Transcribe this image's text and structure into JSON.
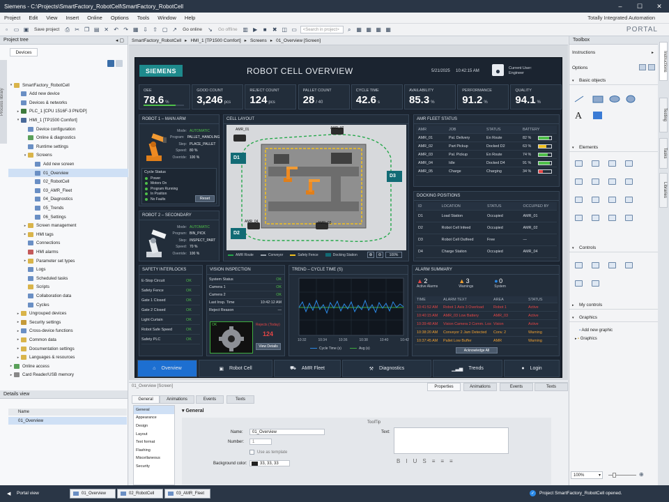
{
  "window": {
    "title": "Siemens  -  C:\\Projects\\SmartFactory_RobotCell\\SmartFactory_RobotCell"
  },
  "menu": [
    "Project",
    "Edit",
    "View",
    "Insert",
    "Online",
    "Options",
    "Tools",
    "Window",
    "Help"
  ],
  "tia": "Totally Integrated Automation",
  "portal": "PORTAL",
  "toolbar": {
    "save": "Save project",
    "go_online": "Go online",
    "go_offline": "Go offline",
    "search_placeholder": "<Search in project>"
  },
  "project_tree": {
    "title": "Project tree",
    "tab": "Devices",
    "vtab": "Process library",
    "items": [
      {
        "label": "SmartFactory_RobotCell",
        "level": 0,
        "arrow": "▾",
        "color": "#d9b44a"
      },
      {
        "label": "Add new device",
        "level": 1,
        "arrow": "",
        "color": "#6a8fc4"
      },
      {
        "label": "Devices & networks",
        "level": 1,
        "arrow": "",
        "color": "#6a8fc4"
      },
      {
        "label": "PLC_1 [CPU 1516F-3 PN/DP]",
        "level": 1,
        "arrow": "▸",
        "color": "#3d7a3d"
      },
      {
        "label": "HMI_1 [TP1500 Comfort]",
        "level": 1,
        "arrow": "▾",
        "color": "#4a6a9a"
      },
      {
        "label": "Device configuration",
        "level": 2,
        "arrow": "",
        "color": "#6a8fc4"
      },
      {
        "label": "Online & diagnostics",
        "level": 2,
        "arrow": "",
        "color": "#5aa05a"
      },
      {
        "label": "Runtime settings",
        "level": 2,
        "arrow": "",
        "color": "#6a8fc4"
      },
      {
        "label": "Screens",
        "level": 2,
        "arrow": "▾",
        "color": "#d9b44a"
      },
      {
        "label": "Add new screen",
        "level": 3,
        "arrow": "",
        "color": "#6a8fc4"
      },
      {
        "label": "01_Overview",
        "level": 3,
        "arrow": "",
        "color": "#6a8fc4",
        "sel": true
      },
      {
        "label": "02_RobotCell",
        "level": 3,
        "arrow": "",
        "color": "#6a8fc4"
      },
      {
        "label": "03_AMR_Fleet",
        "level": 3,
        "arrow": "",
        "color": "#6a8fc4"
      },
      {
        "label": "04_Diagnostics",
        "level": 3,
        "arrow": "",
        "color": "#6a8fc4"
      },
      {
        "label": "05_Trends",
        "level": 3,
        "arrow": "",
        "color": "#6a8fc4"
      },
      {
        "label": "06_Settings",
        "level": 3,
        "arrow": "",
        "color": "#6a8fc4"
      },
      {
        "label": "Screen management",
        "level": 2,
        "arrow": "▸",
        "color": "#d9b44a"
      },
      {
        "label": "HMI tags",
        "level": 2,
        "arrow": "▸",
        "color": "#d9b44a"
      },
      {
        "label": "Connections",
        "level": 2,
        "arrow": "",
        "color": "#6a8fc4"
      },
      {
        "label": "HMI alarms",
        "level": 2,
        "arrow": "",
        "color": "#c45a5a"
      },
      {
        "label": "Parameter set types",
        "level": 2,
        "arrow": "▸",
        "color": "#d9b44a"
      },
      {
        "label": "Logs",
        "level": 2,
        "arrow": "",
        "color": "#6a8fc4"
      },
      {
        "label": "Scheduled tasks",
        "level": 2,
        "arrow": "",
        "color": "#6a8fc4"
      },
      {
        "label": "Scripts",
        "level": 2,
        "arrow": "",
        "color": "#d9b44a"
      },
      {
        "label": "Collaboration data",
        "level": 2,
        "arrow": "",
        "color": "#6a8fc4"
      },
      {
        "label": "Cycles",
        "level": 2,
        "arrow": "",
        "color": "#6a8fc4"
      },
      {
        "label": "Ungrouped devices",
        "level": 1,
        "arrow": "▸",
        "color": "#d9b44a"
      },
      {
        "label": "Security settings",
        "level": 1,
        "arrow": "▸",
        "color": "#c49a3a"
      },
      {
        "label": "Cross-device functions",
        "level": 1,
        "arrow": "▸",
        "color": "#6a8fc4"
      },
      {
        "label": "Common data",
        "level": 1,
        "arrow": "▸",
        "color": "#d9b44a"
      },
      {
        "label": "Documentation settings",
        "level": 1,
        "arrow": "▸",
        "color": "#d9b44a"
      },
      {
        "label": "Languages & resources",
        "level": 1,
        "arrow": "▸",
        "color": "#d9b44a"
      },
      {
        "label": "Online access",
        "level": 0,
        "arrow": "▸",
        "color": "#5aa05a"
      },
      {
        "label": "Card Reader/USB memory",
        "level": 0,
        "arrow": "▸",
        "color": "#888"
      }
    ]
  },
  "details": {
    "title": "Details view",
    "col": "Name",
    "item": "01_Overview"
  },
  "breadcrumb": [
    "SmartFactory_RobotCell",
    "▸",
    "HMI_1 [TP1500 Comfort]",
    "▸",
    "Screens",
    "▸",
    "01_Overview [Screen]"
  ],
  "hmi": {
    "brand": "SIEMENS",
    "title": "ROBOT CELL OVERVIEW",
    "date": "5/21/2025",
    "time": "10:42:15 AM",
    "user_label": "Current User:",
    "user": "Engineer",
    "kpis": [
      {
        "label": "OEE",
        "value": "78.6",
        "unit": "%",
        "cls": "green",
        "bar": 0.786
      },
      {
        "label": "GOOD COUNT",
        "value": "3,246",
        "unit": "pcs",
        "cls": ""
      },
      {
        "label": "REJECT COUNT",
        "value": "124",
        "unit": "pcs",
        "cls": "red"
      },
      {
        "label": "PALLET COUNT",
        "value": "28",
        "unit": "/ 40",
        "cls": ""
      },
      {
        "label": "CYCLE TIME",
        "value": "42.6",
        "unit": "s",
        "cls": ""
      },
      {
        "label": "AVAILABILITY",
        "value": "85.3",
        "unit": "%",
        "cls": ""
      },
      {
        "label": "PERFORMANCE",
        "value": "91.2",
        "unit": "%",
        "cls": ""
      },
      {
        "label": "QUALITY",
        "value": "94.1",
        "unit": "%",
        "cls": ""
      }
    ],
    "robot1": {
      "title": "ROBOT 1 – MAIN ARM",
      "fields": [
        [
          "Mode:",
          "AUTOMATIC"
        ],
        [
          "Program:",
          "PALLET_HANDLING"
        ],
        [
          "Step:",
          "PLACE_PALLET"
        ],
        [
          "Speed:",
          "80 %"
        ],
        [
          "Override:",
          "100 %"
        ]
      ],
      "cycle_title": "Cycle Status",
      "status": [
        "Power",
        "Motors On",
        "Program Running",
        "In Position",
        "No Faults"
      ],
      "reset": "Reset"
    },
    "robot2": {
      "title": "ROBOT 2 – SECONDARY",
      "fields": [
        [
          "Mode:",
          "AUTOMATIC"
        ],
        [
          "Program:",
          "BIN_PICK"
        ],
        [
          "Step:",
          "INSPECT_PART"
        ],
        [
          "Speed:",
          "70 %"
        ],
        [
          "Override:",
          "100 %"
        ]
      ]
    },
    "cell": {
      "title": "CELL LAYOUT",
      "amrs": [
        "AMR_01",
        "AMR_02",
        "AMR_03",
        "AMR_04"
      ],
      "docks": [
        "D1",
        "D2",
        "D3"
      ],
      "legend": [
        "AMR Route",
        "Conveyor",
        "Safety Fence",
        "Docking Station"
      ],
      "zoom": "100%"
    },
    "fleet": {
      "title": "AMR FLEET STATUS",
      "cols": [
        "AMR",
        "JOB",
        "STATUS",
        "BATTERY"
      ],
      "rows": [
        [
          "AMR_01",
          "Pal. Delivery",
          "En Route",
          "82 %",
          0.82
        ],
        [
          "AMR_02",
          "Part Pickup",
          "Docked D2",
          "63 %",
          0.63
        ],
        [
          "AMR_03",
          "Pal. Pickup",
          "En Route",
          "74 %",
          0.74
        ],
        [
          "AMR_04",
          "Idle",
          "Docked D4",
          "91 %",
          0.91
        ],
        [
          "AMR_05",
          "Charge",
          "Charging",
          "34 %",
          0.34
        ]
      ]
    },
    "docking": {
      "title": "DOCKING POSITIONS",
      "cols": [
        "ID",
        "LOCATION",
        "STATUS",
        "OCCUPIED BY"
      ],
      "rows": [
        [
          "D1",
          "Load Station",
          "Occupied",
          "AMR_01"
        ],
        [
          "D2",
          "Robot Cell Infeed",
          "Occupied",
          "AMR_02"
        ],
        [
          "D3",
          "Robot Cell Outfeed",
          "Free",
          "—"
        ],
        [
          "D4",
          "Charge Station",
          "Occupied",
          "AMR_04"
        ]
      ]
    },
    "safety": {
      "title": "SAFETY INTERLOCKS",
      "rows": [
        [
          "E-Stop Circuit",
          "OK"
        ],
        [
          "Safety Fence",
          "OK"
        ],
        [
          "Gate 1 Closed",
          "OK"
        ],
        [
          "Gate 2 Closed",
          "OK"
        ],
        [
          "Light Curtain",
          "OK"
        ],
        [
          "Robot Safe Speed",
          "OK"
        ],
        [
          "Safety PLC",
          "OK"
        ]
      ]
    },
    "vision": {
      "title": "VISION INSPECTION",
      "rows": [
        [
          "System Status",
          "OK"
        ],
        [
          "Camera 1",
          "OK"
        ],
        [
          "Camera 2",
          "OK"
        ],
        [
          "Last Insp. Time",
          "10:42:12 AM"
        ],
        [
          "Reject Reason",
          "—"
        ]
      ],
      "ok": "OK",
      "rejects_label": "Rejects (Today)",
      "rejects": "124",
      "details": "View Details"
    },
    "trend": {
      "title": "TREND – CYCLE TIME (s)",
      "legend": [
        "Cycle Time (s)",
        "Avg (s)"
      ]
    },
    "alarms": {
      "title": "ALARM SUMMARY",
      "active": "2",
      "active_label": "Active Alarms",
      "warnings": "3",
      "warnings_label": "Warnings",
      "system": "0",
      "system_label": "System",
      "cols": [
        "TIME",
        "ALARM TEXT",
        "AREA",
        "STATUS"
      ],
      "rows": [
        [
          "10:41:52 AM",
          "Robot 1 Axis 3 Overload",
          "Robot 1",
          "Active",
          "red"
        ],
        [
          "10:40:15 AM",
          "AMR_03 Low Battery",
          "AMR_03",
          "Active",
          "red"
        ],
        [
          "10:39:48 AM",
          "Vision Camera 2 Comm. Lost",
          "Vision",
          "Active",
          "red"
        ],
        [
          "10:38:20 AM",
          "Conveyor 2 Jam Detected",
          "Conv. 2",
          "Warning",
          "orange"
        ],
        [
          "10:37:45 AM",
          "Pallet Low Buffer",
          "AMR",
          "Warning",
          "orange"
        ]
      ],
      "ack": "Acknowledge All"
    },
    "nav": [
      "Overview",
      "Robot Cell",
      "AMR Fleet",
      "Diagnostics",
      "Trends",
      "Login"
    ]
  },
  "properties": {
    "header": "01_Overview [Screen]",
    "tabs_top": [
      "Properties",
      "Animations",
      "Events",
      "Texts"
    ],
    "tabs": [
      "General",
      "Animations",
      "Events",
      "Texts"
    ],
    "left": [
      "General",
      "Appearance",
      "Design",
      "Layout",
      "Text format",
      "Flashing",
      "Miscellaneous",
      "Security"
    ],
    "section": "General",
    "name_label": "Name:",
    "name": "01_Overview",
    "number_label": "Number:",
    "number": "1",
    "template": "Use as template",
    "bg_label": "Background color:",
    "bg": "33, 33, 33",
    "tooltip": "ToolTip",
    "text_label": "Text:",
    "fmt": [
      "B",
      "I",
      "U",
      "S"
    ]
  },
  "toolbox": {
    "title": "Toolbox",
    "options": [
      "Instructions",
      "Options"
    ],
    "sections": [
      "Basic objects",
      "Elements",
      "Controls",
      "My controls",
      "Graphics"
    ],
    "graphics": [
      "Add new graphic",
      "Graphics"
    ],
    "zoom": "100%",
    "tabs": [
      "Instructions",
      "Testing",
      "Tasks",
      "Libraries"
    ]
  },
  "status": {
    "portal": "Portal view",
    "tabs": [
      "01_Overview",
      "02_RobotCell",
      "03_AMR_Fleet"
    ],
    "msg": "Project SmartFactory_RobotCell opened."
  }
}
